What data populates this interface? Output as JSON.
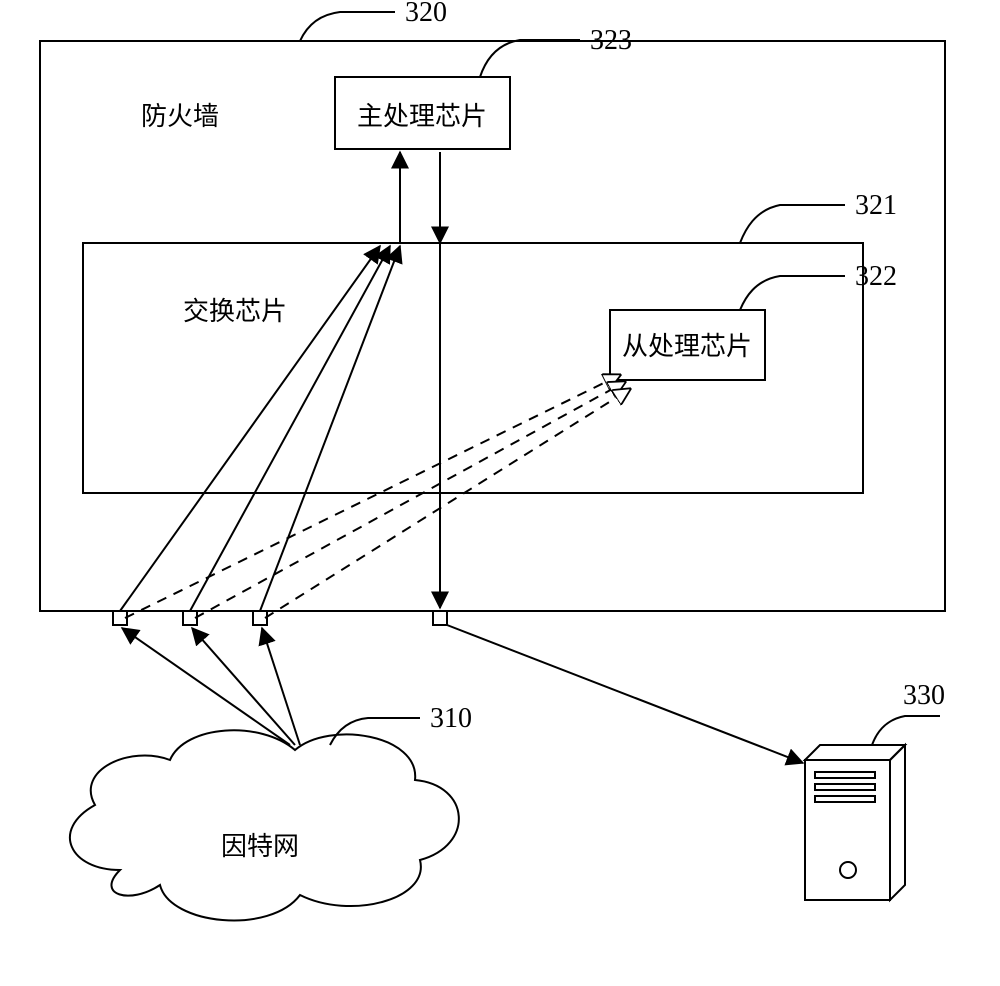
{
  "labels": {
    "firewall": "防火墙",
    "main_chip": "主处理芯片",
    "switch_chip": "交换芯片",
    "slave_chip": "从处理芯片",
    "internet": "因特网"
  },
  "numbers": {
    "firewall": "320",
    "main_chip": "323",
    "switch_chip": "321",
    "slave_chip": "322",
    "internet": "310",
    "server": "330"
  }
}
